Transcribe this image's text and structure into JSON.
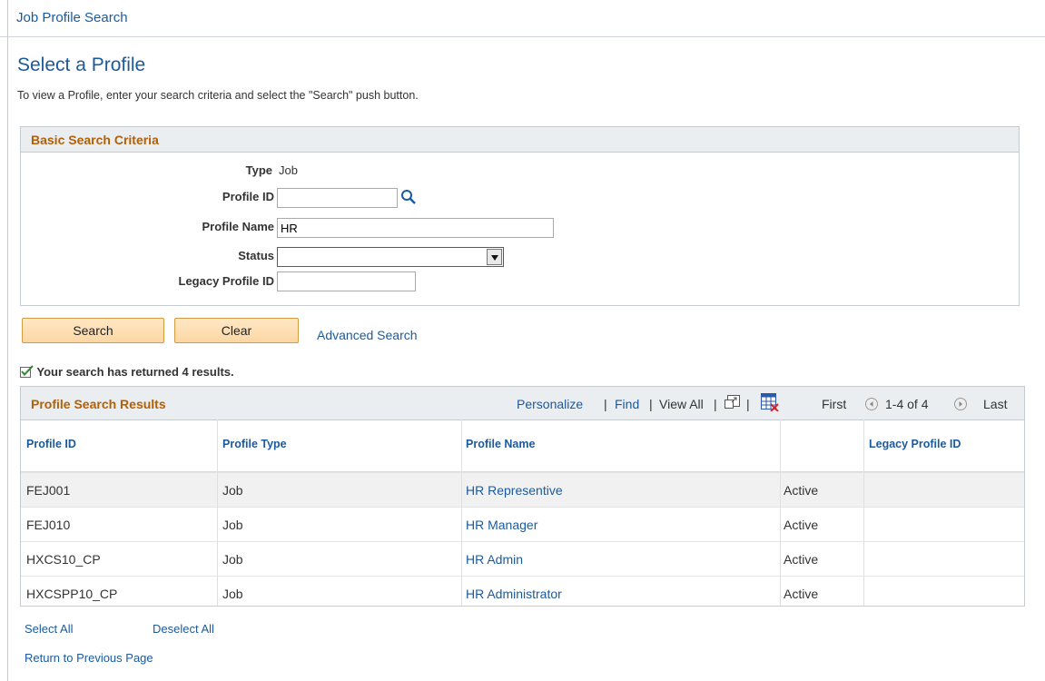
{
  "title_bar": "Job Profile Search",
  "page_title": "Select a Profile",
  "instructions": "To view a Profile, enter your search criteria and select the \"Search\" push button.",
  "criteria": {
    "header": "Basic Search Criteria",
    "type_label": "Type",
    "type_value": "Job",
    "profile_id_label": "Profile ID",
    "profile_id_value": "",
    "profile_name_label": "Profile Name",
    "profile_name_value": "HR",
    "status_label": "Status",
    "status_value": "",
    "legacy_label": "Legacy Profile ID",
    "legacy_value": ""
  },
  "buttons": {
    "search": "Search",
    "clear": "Clear",
    "advanced": "Advanced Search"
  },
  "message": "Your search has returned 4 results.",
  "results": {
    "header": "Profile Search Results",
    "personalize": "Personalize",
    "find": "Find",
    "view_all": "View All",
    "sep": "|",
    "first": "First",
    "range": "1-4 of 4",
    "last": "Last",
    "columns": [
      "Profile ID",
      "Profile Type",
      "Profile Name",
      "",
      "Legacy Profile ID"
    ],
    "rows": [
      {
        "id": "FEJ001",
        "type": "Job",
        "name": "HR Representive",
        "status": "Active",
        "legacy": ""
      },
      {
        "id": "FEJ010",
        "type": "Job",
        "name": "HR Manager",
        "status": "Active",
        "legacy": ""
      },
      {
        "id": "HXCS10_CP",
        "type": "Job",
        "name": "HR Admin",
        "status": "Active",
        "legacy": ""
      },
      {
        "id": "HXCSPP10_CP",
        "type": "Job",
        "name": "HR Administrator",
        "status": "Active",
        "legacy": ""
      }
    ]
  },
  "footer": {
    "select_all": "Select All",
    "deselect_all": "Deselect All",
    "return": "Return to Previous Page"
  },
  "colors": {
    "link": "#1b5a9d",
    "section_title": "#b45f04",
    "button": "#fcd7a4"
  },
  "icons": [
    "lookup-magnifier-icon",
    "dropdown-arrow-icon",
    "success-check-icon",
    "zoom-icon",
    "download-excel-icon",
    "previous-arrow-icon",
    "next-arrow-icon"
  ]
}
